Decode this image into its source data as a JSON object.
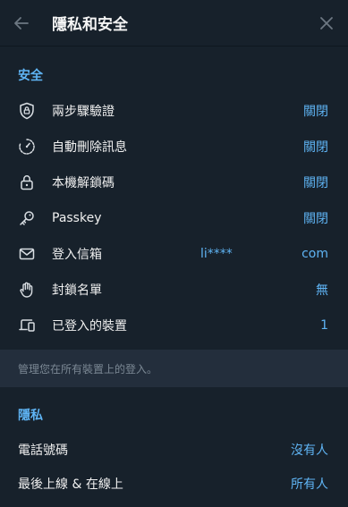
{
  "header": {
    "title": "隱私和安全",
    "back_icon": "arrow-left-icon",
    "close_icon": "close-icon"
  },
  "security": {
    "title": "安全",
    "items": [
      {
        "label": "兩步驟驗證",
        "value": "關閉",
        "icon": "shield-lock-icon"
      },
      {
        "label": "自動刪除訊息",
        "value": "關閉",
        "icon": "timer-icon"
      },
      {
        "label": "本機解鎖碼",
        "value": "關閉",
        "icon": "padlock-icon"
      },
      {
        "label": "Passkey",
        "value": "關閉",
        "icon": "key-icon"
      },
      {
        "label": "登入信箱",
        "value_left": "li****",
        "value": "com",
        "icon": "envelope-icon"
      },
      {
        "label": "封鎖名單",
        "value": "無",
        "icon": "hand-icon"
      },
      {
        "label": "已登入的裝置",
        "value": "1",
        "icon": "devices-icon"
      }
    ],
    "note": "管理您在所有裝置上的登入。"
  },
  "privacy": {
    "title": "隱私",
    "items": [
      {
        "label": "電話號碼",
        "value": "沒有人"
      },
      {
        "label": "最後上線 & 在線上",
        "value": "所有人"
      }
    ]
  },
  "colors": {
    "background": "#17212b",
    "accent": "#5fb4f4",
    "note_background": "#232e3c"
  }
}
